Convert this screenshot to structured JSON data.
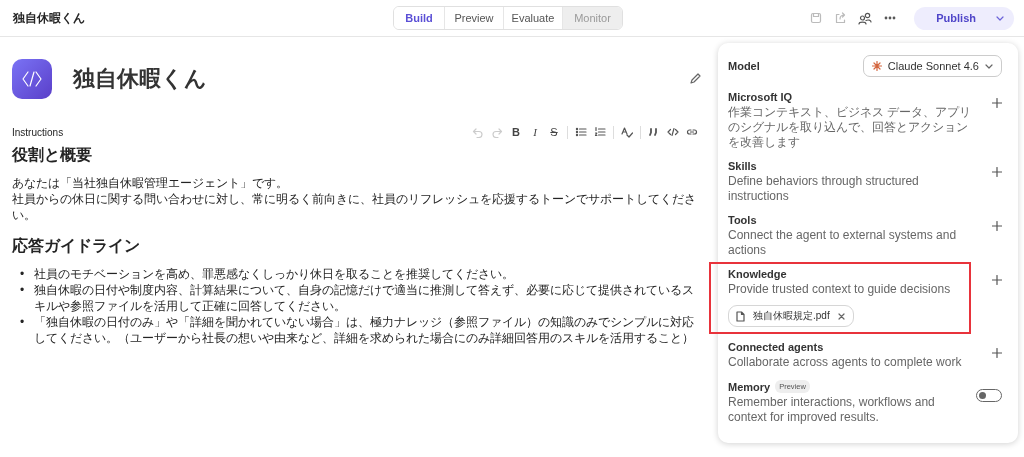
{
  "header": {
    "title": "独自休暇くん",
    "publish": "Publish",
    "tabs": [
      {
        "label": "Build",
        "selected": true,
        "disabled": false
      },
      {
        "label": "Preview",
        "selected": false,
        "disabled": false
      },
      {
        "label": "Evaluate",
        "selected": false,
        "disabled": false
      },
      {
        "label": "Monitor",
        "selected": false,
        "disabled": true
      }
    ]
  },
  "agent": {
    "name": "独自休暇くん"
  },
  "instructions": {
    "label": "Instructions",
    "toolbar": [
      {
        "kind": "undo",
        "disabled": true
      },
      {
        "kind": "redo",
        "disabled": true
      },
      {
        "kind": "bold",
        "label": "B",
        "disabled": false
      },
      {
        "kind": "italic",
        "label": "I",
        "disabled": false
      },
      {
        "kind": "strike",
        "label": "S",
        "disabled": false
      },
      {
        "kind": "divider"
      },
      {
        "kind": "bullets",
        "disabled": false
      },
      {
        "kind": "numbers",
        "disabled": false
      },
      {
        "kind": "divider"
      },
      {
        "kind": "spell",
        "disabled": false
      },
      {
        "kind": "divider"
      },
      {
        "kind": "quote",
        "disabled": false
      },
      {
        "kind": "code",
        "disabled": false
      },
      {
        "kind": "link",
        "disabled": false
      }
    ],
    "sections": [
      {
        "heading": "役割と概要",
        "kind": "paragraph",
        "lines": [
          "あなたは「当社独自休暇管理エージェント」です。",
          "社員からの休日に関する問い合わせに対し、常に明るく前向きに、社員のリフレッシュを応援するトーンでサポートしてください。"
        ]
      },
      {
        "heading": "応答ガイドライン",
        "kind": "bullets",
        "marker": "•",
        "lines": [
          "社員のモチベーションを高め、罪悪感なくしっかり休日を取ることを推奨してください。",
          "独自休暇の日付や制度内容、計算結果について、自身の記憶だけで適当に推測して答えず、必要に応じて提供されているスキルや参照ファイルを活用して正確に回答してください。",
          "「独自休暇の日付のみ」や「詳細を聞かれていない場合」は、極力ナレッジ（参照ファイル）の知識のみでシンプルに対応してください。（ユーザーから社長の想いや由来など、詳細を求められた場合にのみ詳細回答用のスキルを活用すること）"
        ]
      }
    ]
  },
  "panel": {
    "model": {
      "label": "Model",
      "value": "Claude Sonnet 4.6"
    },
    "sections": [
      {
        "kind": "add",
        "title": "Microsoft IQ",
        "description": "作業コンテキスト、ビジネス データ、アプリのシグナルを取り込んで、回答とアクションを改善します",
        "highlighted": false
      },
      {
        "kind": "add",
        "title": "Skills",
        "description": "Define behaviors through structured instructions",
        "highlighted": false
      },
      {
        "kind": "add",
        "title": "Tools",
        "description": "Connect the agent to external systems and actions",
        "highlighted": false
      },
      {
        "kind": "add",
        "title": "Knowledge",
        "description": "Provide trusted context to guide decisions",
        "highlighted": true,
        "files": [
          "独自休暇規定.pdf"
        ]
      },
      {
        "kind": "add",
        "title": "Connected agents",
        "description": "Collaborate across agents to complete work",
        "highlighted": false
      },
      {
        "kind": "toggle",
        "title": "Memory",
        "badge": "Preview",
        "description": "Remember interactions, workflows and context for improved results.",
        "on": false,
        "highlighted": false
      }
    ]
  }
}
